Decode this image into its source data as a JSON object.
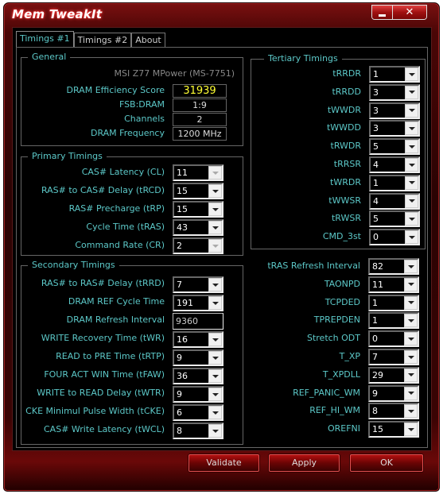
{
  "window": {
    "title": "Mem TweakIt",
    "minimize_label": "_",
    "close_label": "✕"
  },
  "tabs": [
    {
      "label": "Timings #1",
      "active": true
    },
    {
      "label": "Timings #2",
      "active": false
    },
    {
      "label": "About",
      "active": false
    }
  ],
  "general": {
    "title": "General",
    "board": "MSI Z77 MPower (MS-7751)",
    "fields": [
      {
        "label": "DRAM Efficiency Score",
        "value": "31939"
      },
      {
        "label": "FSB:DRAM",
        "value": "1:9"
      },
      {
        "label": "Channels",
        "value": "2"
      },
      {
        "label": "DRAM Frequency",
        "value": "1200 MHz"
      }
    ]
  },
  "primary": {
    "title": "Primary Timings",
    "fields": [
      {
        "label": "CAS# Latency (CL)",
        "value": "11",
        "disabled": true
      },
      {
        "label": "RAS# to CAS# Delay (tRCD)",
        "value": "15",
        "disabled": false
      },
      {
        "label": "RAS# Precharge (tRP)",
        "value": "15",
        "disabled": false
      },
      {
        "label": "Cycle Time (tRAS)",
        "value": "43",
        "disabled": false
      },
      {
        "label": "Command Rate (CR)",
        "value": "2",
        "disabled": true
      }
    ]
  },
  "secondary": {
    "title": "Secondary Timings",
    "fields": [
      {
        "label": "RAS# to RAS# Delay (tRRD)",
        "value": "7",
        "type": "combo"
      },
      {
        "label": "DRAM REF Cycle Time",
        "value": "191",
        "type": "combo"
      },
      {
        "label": "DRAM Refresh Interval",
        "value": "9360",
        "type": "text"
      },
      {
        "label": "WRITE Recovery Time (tWR)",
        "value": "16",
        "type": "combo"
      },
      {
        "label": "READ to PRE Time (tRTP)",
        "value": "9",
        "type": "combo"
      },
      {
        "label": "FOUR ACT WIN Time (tFAW)",
        "value": "36",
        "type": "combo"
      },
      {
        "label": "WRITE to READ Delay (tWTR)",
        "value": "9",
        "type": "combo"
      },
      {
        "label": "CKE Minimul Pulse Width (tCKE)",
        "value": "6",
        "type": "combo"
      },
      {
        "label": "CAS# Write Latency (tWCL)",
        "value": "8",
        "type": "combo"
      }
    ]
  },
  "tertiary": {
    "title": "Tertiary Timings",
    "fields": [
      {
        "label": "tRRDR",
        "value": "1"
      },
      {
        "label": "tRRDD",
        "value": "3"
      },
      {
        "label": "tWWDR",
        "value": "3"
      },
      {
        "label": "tWWDD",
        "value": "3"
      },
      {
        "label": "tRWDR",
        "value": "5"
      },
      {
        "label": "tRRSR",
        "value": "4"
      },
      {
        "label": "tWRDR",
        "value": "1"
      },
      {
        "label": "tWWSR",
        "value": "4"
      },
      {
        "label": "tRWSR",
        "value": "5"
      },
      {
        "label": "CMD_3st",
        "value": "0"
      }
    ]
  },
  "misc": {
    "fields": [
      {
        "label": "tRAS Refresh Interval",
        "value": "82"
      },
      {
        "label": "TAONPD",
        "value": "11"
      },
      {
        "label": "TCPDED",
        "value": "1"
      },
      {
        "label": "TPREPDEN",
        "value": "1"
      },
      {
        "label": "Stretch ODT",
        "value": "0"
      },
      {
        "label": "T_XP",
        "value": "7"
      },
      {
        "label": "T_XPDLL",
        "value": "29"
      },
      {
        "label": "REF_PANIC_WM",
        "value": "9"
      },
      {
        "label": "REF_HI_WM",
        "value": "8"
      },
      {
        "label": "OREFNI",
        "value": "15"
      }
    ]
  },
  "buttons": {
    "validate": "Validate",
    "apply": "Apply",
    "ok": "OK"
  },
  "colors": {
    "accent_text": "#5cc8c8",
    "score": "#ffff33",
    "frame": "#4a0606"
  }
}
